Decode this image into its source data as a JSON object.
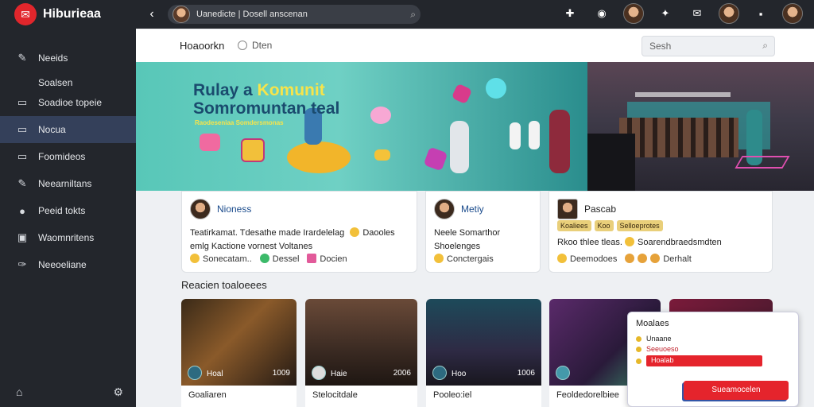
{
  "app": {
    "name": "Hiburieaa"
  },
  "sidebar": {
    "items": [
      {
        "label": "Neeids",
        "icon": "pencil-icon"
      },
      {
        "label": "Soadioe topeie",
        "icon": "window-icon"
      },
      {
        "label": "Nocua",
        "icon": "window-icon",
        "active": true
      },
      {
        "label": "Foomideos",
        "icon": "window-icon"
      },
      {
        "label": "Neearniltans",
        "icon": "pencil-icon"
      },
      {
        "label": "Peeid tokts",
        "icon": "chat-icon"
      },
      {
        "label": "Waomnritens",
        "icon": "briefcase-icon"
      },
      {
        "label": "Neeoeliane",
        "icon": "wrench-icon"
      }
    ],
    "section": "Soalsen"
  },
  "topbar": {
    "search_text": "Uanedicte  |  Dosell anscenan"
  },
  "subheader": {
    "title": "Hoaoorkn",
    "tab": "Dten",
    "search_placeholder": "Sesh"
  },
  "banner": {
    "title_line1": "Rulay a ",
    "title_highlight": "Komunit",
    "title_line2": "Somromuntan teal",
    "subtitle": "Raodeseniaa Somdersmonas"
  },
  "cards": [
    {
      "name": "Nioness",
      "text": "Teatirkamat. Tdesathe made Irardelelag",
      "text2": "Daooles",
      "text3": "emlg Kactione vornest Voltanes",
      "foot": [
        "Sonecatam..",
        "Dessel",
        "Docien"
      ]
    },
    {
      "name": "Metiy",
      "text": "Neele Somarthor",
      "text2": "Shoelenges",
      "foot": [
        "Conctergais"
      ]
    },
    {
      "name": "Pascab",
      "tags": [
        "Koaliees",
        "Koo",
        "Selloeprotes"
      ],
      "text": "Rkoo thlee tleas.",
      "text2": "Soarendbraedsmdten",
      "foot": [
        "Deemodoes",
        "Derhalt"
      ]
    }
  ],
  "section_title": "Reacien toaloeees",
  "thumbs": [
    {
      "title": "Goaliaren",
      "label": "Hoal",
      "count": "1009"
    },
    {
      "title": "Stelocitdale",
      "label": "Haie",
      "count": "2006"
    },
    {
      "title": "Pooleo:iel",
      "label": "Hoo",
      "count": "1006"
    },
    {
      "title": "Feoldedorelbiee",
      "label": "",
      "count": ""
    },
    {
      "title": "",
      "label": "",
      "count": ""
    }
  ],
  "popup": {
    "title": "Moalaes",
    "rows": [
      "Unaane",
      "Seeuoeso",
      "Hoalab"
    ],
    "button": "Sueamocelen"
  },
  "colors": {
    "accent": "#e5242c",
    "sidebar": "#23262c",
    "active": "#34405a"
  }
}
